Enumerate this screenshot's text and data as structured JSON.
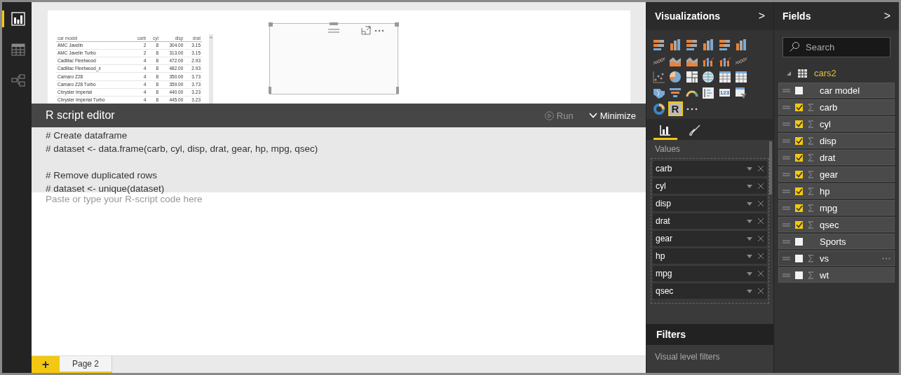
{
  "nav": [
    {
      "kind": "report",
      "selected": true
    },
    {
      "kind": "data",
      "selected": false
    },
    {
      "kind": "relationships",
      "selected": false
    }
  ],
  "table_visual": {
    "columns": [
      "car model",
      "carb",
      "cyl",
      "disp",
      "drat"
    ],
    "rows": [
      [
        "AMC Javelin",
        "2",
        "8",
        "304.00",
        "3.15"
      ],
      [
        "AMC Javelin Turbo",
        "2",
        "8",
        "313.00",
        "3.15"
      ],
      [
        "Cadillac Fleetwood",
        "4",
        "8",
        "472.00",
        "2.93"
      ],
      [
        "Cadillac Fleetwood_x",
        "4",
        "8",
        "482.00",
        "2.93"
      ],
      [
        "Camaro Z28",
        "4",
        "8",
        "350.00",
        "3.73"
      ],
      [
        "Camaro Z28 Turbo",
        "4",
        "8",
        "359.00",
        "3.73"
      ],
      [
        "Chrysler Imperial",
        "4",
        "8",
        "440.00",
        "3.23"
      ],
      [
        "Chrysler Imperial Turbo",
        "4",
        "8",
        "445.00",
        "3.23"
      ]
    ]
  },
  "r_editor": {
    "title": "R script editor",
    "run": "Run",
    "minimize": "Minimize",
    "code_blocks": [
      [
        "# Create dataframe",
        "# dataset <- data.frame(carb, cyl, disp, drat, gear, hp, mpg, qsec)"
      ],
      [
        "# Remove duplicated rows",
        "# dataset <- unique(dataset)"
      ]
    ],
    "placeholder": "Paste or type your R-script code here"
  },
  "pages": {
    "add": "+",
    "tabs": [
      {
        "label": "Page 2",
        "selected": true
      }
    ]
  },
  "visualizations": {
    "title": "Visualizations",
    "arrow": ">",
    "types": [
      {
        "kind": "hbar",
        "selected": false
      },
      {
        "kind": "vbar",
        "selected": false
      },
      {
        "kind": "hbar",
        "selected": false
      },
      {
        "kind": "vbar",
        "selected": false
      },
      {
        "kind": "hbar",
        "selected": false
      },
      {
        "kind": "vbar",
        "selected": false
      },
      {
        "kind": "line",
        "selected": false
      },
      {
        "kind": "area",
        "selected": false
      },
      {
        "kind": "area",
        "selected": false
      },
      {
        "kind": "combo",
        "selected": false
      },
      {
        "kind": "combo",
        "selected": false
      },
      {
        "kind": "line",
        "selected": false
      },
      {
        "kind": "scatter",
        "selected": false
      },
      {
        "kind": "pie",
        "selected": false
      },
      {
        "kind": "treemap",
        "selected": false
      },
      {
        "kind": "globe",
        "selected": false
      },
      {
        "kind": "table",
        "selected": false
      },
      {
        "kind": "table",
        "selected": false
      },
      {
        "kind": "map",
        "selected": false
      },
      {
        "kind": "funnel",
        "selected": false
      },
      {
        "kind": "gauge",
        "selected": false
      },
      {
        "kind": "slicer",
        "selected": false
      },
      {
        "kind": "card",
        "label": "123",
        "selected": false
      },
      {
        "kind": "filter",
        "selected": false
      },
      {
        "kind": "donut",
        "selected": false
      },
      {
        "kind": "r",
        "label": "R",
        "selected": true
      }
    ],
    "tabs": [
      {
        "kind": "fields",
        "selected": true
      },
      {
        "kind": "format",
        "selected": false
      }
    ],
    "values_label": "Values",
    "values": [
      "carb",
      "cyl",
      "disp",
      "drat",
      "gear",
      "hp",
      "mpg",
      "qsec"
    ],
    "filters_title": "Filters",
    "visual_filters": "Visual level filters"
  },
  "fields": {
    "title": "Fields",
    "arrow": ">",
    "search": {
      "placeholder": "Search"
    },
    "table": "cars2",
    "items": [
      {
        "name": "car model",
        "kind": "text",
        "checked": false,
        "hovered": false
      },
      {
        "name": "carb",
        "kind": "measure",
        "checked": true,
        "hovered": false
      },
      {
        "name": "cyl",
        "kind": "measure",
        "checked": true,
        "hovered": false
      },
      {
        "name": "disp",
        "kind": "measure",
        "checked": true,
        "hovered": false
      },
      {
        "name": "drat",
        "kind": "measure",
        "checked": true,
        "hovered": false
      },
      {
        "name": "gear",
        "kind": "measure",
        "checked": true,
        "hovered": false
      },
      {
        "name": "hp",
        "kind": "measure",
        "checked": true,
        "hovered": false
      },
      {
        "name": "mpg",
        "kind": "measure",
        "checked": true,
        "hovered": false
      },
      {
        "name": "qsec",
        "kind": "measure",
        "checked": true,
        "hovered": false
      },
      {
        "name": "Sports",
        "kind": "text",
        "checked": false,
        "hovered": false
      },
      {
        "name": "vs",
        "kind": "measure",
        "checked": false,
        "hovered": true
      },
      {
        "name": "wt",
        "kind": "measure",
        "checked": false,
        "hovered": false
      }
    ]
  }
}
